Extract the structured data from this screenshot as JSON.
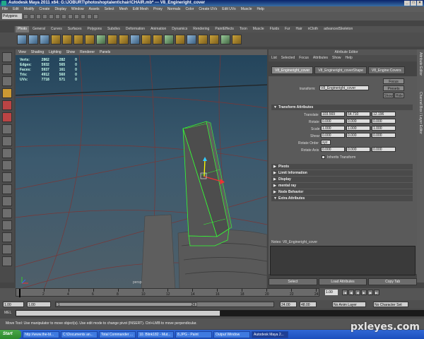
{
  "window": {
    "title": "Autodesk Maya 2011 x64: G:\\JOBURT\\photoshoptalent\\chair\\CHAIR.mb* --- V8_Engineright_cover"
  },
  "menubar": [
    "File",
    "Edit",
    "Modify",
    "Create",
    "Display",
    "Window",
    "Assets",
    "Select",
    "Mesh",
    "Edit Mesh",
    "Proxy",
    "Normals",
    "Color",
    "Create UVs",
    "Edit UVs",
    "Muscle",
    "Help"
  ],
  "status": {
    "mode": "Polygons"
  },
  "shelf": {
    "tabs": [
      "Photo",
      "General",
      "Curves",
      "Surfaces",
      "Polygons",
      "Subdivs",
      "Deformation",
      "Animation",
      "Dynamics",
      "Rendering",
      "PaintEffects",
      "Toon",
      "Muscle",
      "Fluids",
      "Fur",
      "Hair",
      "nCloth",
      "advancedSkeleton"
    ],
    "active_tab": "Photo"
  },
  "viewport": {
    "menu": [
      "View",
      "Shading",
      "Lighting",
      "Show",
      "Renderer",
      "Panels"
    ],
    "hud": [
      {
        "label": "Verts:",
        "v1": "2862",
        "v2": "282",
        "v3": "0"
      },
      {
        "label": "Edges:",
        "v1": "5932",
        "v2": "565",
        "v3": "0"
      },
      {
        "label": "Faces:",
        "v1": "5937",
        "v2": "161",
        "v3": "0"
      },
      {
        "label": "Tris:",
        "v1": "4912",
        "v2": "560",
        "v3": "0"
      },
      {
        "label": "UVs:",
        "v1": "7718",
        "v2": "571",
        "v3": "0"
      }
    ],
    "camera": "persp"
  },
  "attr": {
    "title": "Attribute Editor",
    "menu": [
      "List",
      "Selected",
      "Focus",
      "Attributes",
      "Show",
      "Help"
    ],
    "tabs": [
      "V8_Engineright_cover",
      "V8_Engineright_coverShape",
      "V8_Engine:Covers"
    ],
    "transform_label": "transform:",
    "transform_value": "V8_Engineright_cover",
    "buttons": {
      "focus": "Focus",
      "presets": "Presets",
      "show": "Show",
      "hide": "Hide"
    },
    "section_transform": "Transform Attributes",
    "rows": {
      "translate": {
        "label": "Translate",
        "x": "103.569",
        "y": "64.710",
        "z": "12.196"
      },
      "rotate": {
        "label": "Rotate",
        "x": "0.000",
        "y": "0.000",
        "z": "0.000"
      },
      "scale": {
        "label": "Scale",
        "x": "1.000",
        "y": "1.000",
        "z": "1.000"
      },
      "shear": {
        "label": "Shear",
        "x": "0.000",
        "y": "0.000",
        "z": "0.000"
      },
      "rotate_order": {
        "label": "Rotate Order",
        "value": "xyz"
      },
      "rotate_axis": {
        "label": "Rotate Axis",
        "x": "0.000",
        "y": "0.000",
        "z": "0.000"
      },
      "inherits": {
        "label": "Inherits Transform"
      }
    },
    "sections": [
      "Pivots",
      "Limit Information",
      "Display",
      "mental ray",
      "Node Behavior",
      "Extra Attributes"
    ],
    "notes": "Notes: V8_Engineright_cover",
    "bottom_buttons": [
      "Select",
      "Load Attributes",
      "Copy Tab"
    ],
    "side_tabs": [
      "Attribute Editor",
      "Channel Box / Layer Editor"
    ]
  },
  "timeline": {
    "ticks": [
      "2",
      "4",
      "6",
      "8",
      "10",
      "12",
      "14",
      "16",
      "18",
      "20",
      "22",
      "24"
    ],
    "current_frame": "1.00",
    "playback": [
      "|◀",
      "◀|",
      "◀",
      "▶",
      "|▶",
      "▶|"
    ]
  },
  "range": {
    "start": "1.00",
    "inner_start": "1.00",
    "slider_start": "1",
    "slider_end": "24",
    "end": "24.00",
    "total": "48.00",
    "anim_layer": "No Anim Layer",
    "char_set": "No Character Set"
  },
  "cmdline": {
    "label": "MEL"
  },
  "helpline": "Move Tool: Use manipulator to move object(s). Use edit mode to change pivot (INSERT). Ctrl+LMB to move perpendicular.",
  "taskbar": {
    "start": "Start",
    "tasks": [
      "http://www.the-bl...",
      "C:\\Documents an...",
      "Total Commander ...",
      "10. Blink182 - Mut...",
      "8.JPG - Paint",
      "Output Window",
      "Autodesk Maya 2..."
    ],
    "active_index": 6
  },
  "watermark": "pxleyes.com"
}
